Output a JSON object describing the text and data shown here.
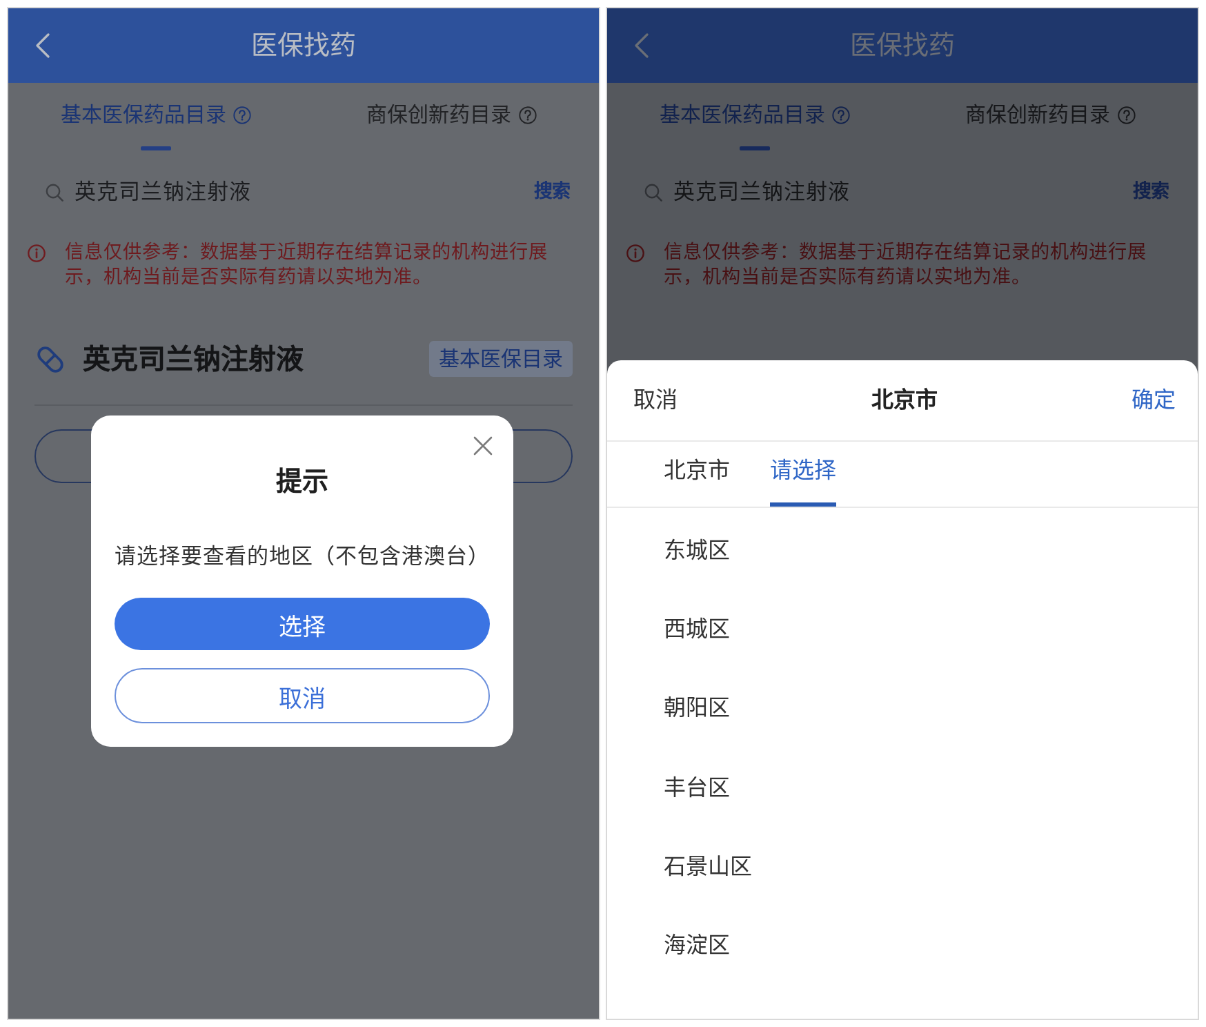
{
  "screens": [
    {
      "app_bar": {
        "title": "医保找药"
      },
      "tabs": [
        {
          "label": "基本医保药品目录",
          "selected": true
        },
        {
          "label": "商保创新药目录",
          "selected": false
        }
      ],
      "search": {
        "value": "英克司兰钠注射液",
        "button": "搜索"
      },
      "notice": "信息仅供参考：数据基于近期存在结算记录的机构进行展示，机构当前是否实际有药请以实地为准。",
      "drug": {
        "name": "英克司兰钠注射液",
        "tag": "基本医保目录",
        "outline_button": true
      },
      "overlay": {
        "kind": "dialog",
        "title": "提示",
        "message": "请选择要查看的地区（不包含港澳台）",
        "buttons": [
          {
            "label": "选择",
            "kind": "primary"
          },
          {
            "label": "取消",
            "kind": "secondary"
          }
        ]
      }
    },
    {
      "app_bar": {
        "title": "医保找药"
      },
      "tabs": [
        {
          "label": "基本医保药品目录",
          "selected": true
        },
        {
          "label": "商保创新药目录",
          "selected": false
        }
      ],
      "search": {
        "value": "英克司兰钠注射液",
        "button": "搜索"
      },
      "notice": "信息仅供参考：数据基于近期存在结算记录的机构进行展示，机构当前是否实际有药请以实地为准。",
      "overlay": {
        "kind": "picker",
        "cancel": "取消",
        "title": "北京市",
        "confirm": "确定",
        "tabs": [
          {
            "label": "北京市",
            "selected": false
          },
          {
            "label": "请选择",
            "selected": true
          }
        ],
        "items": [
          "东城区",
          "西城区",
          "朝阳区",
          "丰台区",
          "石景山区",
          "海淀区"
        ]
      }
    }
  ]
}
